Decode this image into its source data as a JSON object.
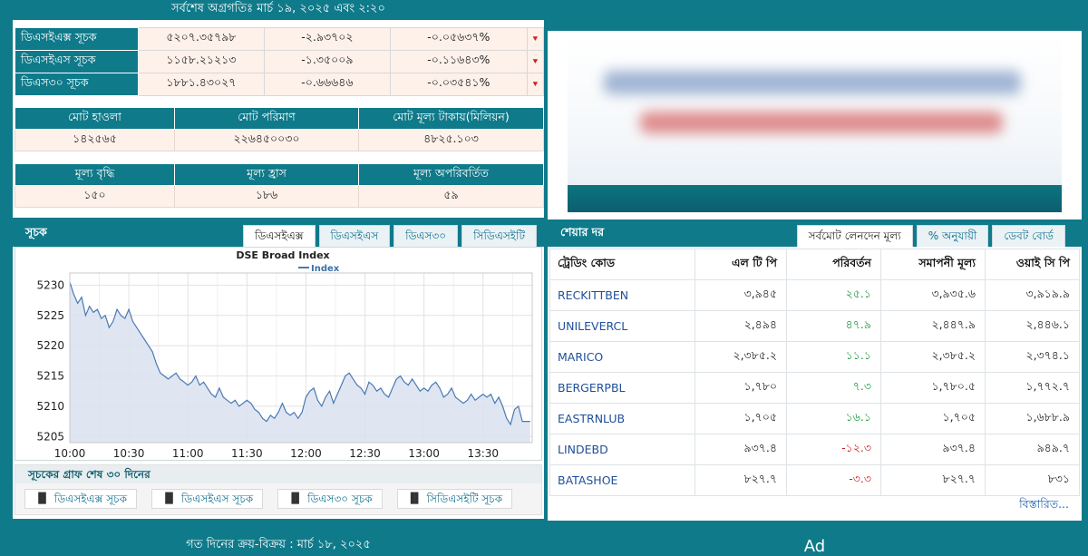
{
  "header": {
    "latest_update": "সর্বশেষ অগ্রগতিঃ মার্চ ১৯, ২০২৫ এবং ২:২০"
  },
  "indices": [
    {
      "name": "ডিএসইএক্স সূচক",
      "value": "৫২০৭.৩৫৭৯৮",
      "change": "-২.৯৩৭০২",
      "pct": "-০.০৫৬৩৭%"
    },
    {
      "name": "ডিএসইএস সূচক",
      "value": "১১৫৮.২১২১৩",
      "change": "-১.৩৫০০৯",
      "pct": "-০.১১৬৪৩%"
    },
    {
      "name": "ডিএস৩০ সূচক",
      "value": "১৮৮১.৪৩০২৭",
      "change": "-০.৬৬৬৪৬",
      "pct": "-০.০৩৫৪১%"
    }
  ],
  "trade_summary": {
    "headers": [
      "মোট হাওলা",
      "মোট পরিমাণ",
      "মোট মূল্য টাকায়(মিলিয়ন)"
    ],
    "values": [
      "১৪২৫৬৫",
      "২২৬৪৫০০৩০",
      "৪৮২৫.১০৩"
    ]
  },
  "price_summary": {
    "headers": [
      "মূল্য বৃদ্ধি",
      "মূল্য হ্রাস",
      "মূল্য অপরিবর্তিত"
    ],
    "values": [
      "১৫০",
      "১৮৬",
      "৫৯"
    ]
  },
  "index_panel": {
    "title": "সূচক",
    "tabs": [
      "ডিএসইএক্স",
      "ডিএসইএস",
      "ডিএস৩০",
      "সিডিএসইটি"
    ],
    "active_tab": 0,
    "footer_title": "সূচকের গ্রাফ শেষ ৩০ দিনের",
    "links": [
      "ডিএসইএক্স সূচক",
      "ডিএসইএস সূচক",
      "ডিএস৩০ সূচক",
      "সিডিএসইটি সূচক"
    ]
  },
  "chart_data": {
    "type": "area",
    "title": "DSE Broad Index",
    "series": [
      {
        "name": "Index"
      }
    ],
    "ylim": [
      5204,
      5232
    ],
    "yticks": [
      5205,
      5210,
      5215,
      5220,
      5225,
      5230
    ],
    "xticks": [
      "10:00",
      "10:30",
      "11:00",
      "11:30",
      "12:00",
      "12:30",
      "13:00",
      "13:30"
    ],
    "x_minutes": [
      0,
      2,
      4,
      6,
      8,
      10,
      12,
      14,
      16,
      18,
      20,
      22,
      24,
      26,
      28,
      30,
      32,
      34,
      36,
      38,
      40,
      42,
      44,
      46,
      48,
      50,
      52,
      54,
      56,
      58,
      60,
      62,
      64,
      66,
      68,
      70,
      72,
      74,
      76,
      78,
      80,
      82,
      84,
      86,
      88,
      90,
      92,
      94,
      96,
      98,
      100,
      102,
      104,
      106,
      108,
      110,
      112,
      114,
      116,
      118,
      120,
      122,
      124,
      126,
      128,
      130,
      132,
      134,
      136,
      138,
      140,
      142,
      144,
      146,
      148,
      150,
      152,
      154,
      156,
      158,
      160,
      162,
      164,
      166,
      168,
      170,
      172,
      174,
      176,
      178,
      180,
      182,
      184,
      186,
      188,
      190,
      192,
      194,
      196,
      198,
      200,
      202,
      204,
      206,
      208,
      210,
      212,
      214,
      216,
      218,
      220,
      222,
      224,
      226,
      228,
      230,
      232,
      234
    ],
    "values": [
      5230.5,
      5228.5,
      5227,
      5228,
      5225,
      5226.5,
      5225.5,
      5226,
      5224.5,
      5225,
      5223,
      5224,
      5226,
      5225,
      5224.5,
      5226,
      5224,
      5223,
      5222,
      5221,
      5220,
      5219,
      5217,
      5215.5,
      5215,
      5214.5,
      5215,
      5215.5,
      5214.5,
      5214,
      5213.5,
      5214,
      5215,
      5213.5,
      5214,
      5213,
      5212,
      5211.5,
      5213,
      5211.5,
      5211,
      5210.5,
      5211,
      5210,
      5210.5,
      5211,
      5210.5,
      5209.5,
      5209,
      5208,
      5207.5,
      5208.5,
      5208,
      5209,
      5210.5,
      5209,
      5208.5,
      5209,
      5208,
      5209,
      5211.5,
      5212.5,
      5213,
      5211,
      5210,
      5211.5,
      5212.5,
      5210.5,
      5212,
      5213.5,
      5215,
      5215.5,
      5214.5,
      5213.5,
      5213,
      5212,
      5214,
      5213.5,
      5212.5,
      5213,
      5212,
      5211.5,
      5213,
      5214.5,
      5215,
      5214,
      5213.5,
      5214.5,
      5213.5,
      5212.5,
      5213,
      5212.5,
      5213.5,
      5214,
      5213,
      5211.5,
      5212,
      5213,
      5211.5,
      5211,
      5210.5,
      5211,
      5212,
      5211,
      5211.5,
      5212,
      5211.5,
      5212,
      5210.5,
      5211.5,
      5210,
      5208,
      5207,
      5209.5,
      5210,
      5207.5,
      5207.5,
      5207.5
    ]
  },
  "share_panel": {
    "title": "শেয়ার দর",
    "tabs": [
      "সর্বমোট লেনদেন মূল্য",
      "% অনুযায়ী",
      "ডেবট বোর্ড"
    ],
    "active_tab": 0,
    "headers": [
      "ট্রেডিং কোড",
      "এল টি পি",
      "পরিবর্তন",
      "সমাপনী মূল্য",
      "ওয়াই সি পি"
    ],
    "rows": [
      {
        "code": "RECKITTBEN",
        "ltp": "৩,৯৪৫",
        "change": "২৫.১",
        "dir": "up",
        "close": "৩,৯৩৫.৬",
        "ycp": "৩,৯১৯.৯"
      },
      {
        "code": "UNILEVERCL",
        "ltp": "২,৪৯৪",
        "change": "৪৭.৯",
        "dir": "up",
        "close": "২,৪৪৭.৯",
        "ycp": "২,৪৪৬.১"
      },
      {
        "code": "MARICO",
        "ltp": "২,৩৮৫.২",
        "change": "১১.১",
        "dir": "up",
        "close": "২,৩৮৫.২",
        "ycp": "২,৩৭৪.১"
      },
      {
        "code": "BERGERPBL",
        "ltp": "১,৭৮০",
        "change": "৭.৩",
        "dir": "up",
        "close": "১,৭৮০.৫",
        "ycp": "১,৭৭২.৭"
      },
      {
        "code": "EASTRNLUB",
        "ltp": "১,৭০৫",
        "change": "১৬.১",
        "dir": "up",
        "close": "১,৭০৫",
        "ycp": "১,৬৮৮.৯"
      },
      {
        "code": "LINDEBD",
        "ltp": "৯৩৭.৪",
        "change": "-১২.৩",
        "dir": "down",
        "close": "৯৩৭.৪",
        "ycp": "৯৪৯.৭"
      },
      {
        "code": "BATASHOE",
        "ltp": "৮২৭.৭",
        "change": "-৩.৩",
        "dir": "down",
        "close": "৮২৭.৭",
        "ycp": "৮৩১"
      }
    ],
    "more_link": "বিস্তারিত..."
  },
  "bottom": {
    "prev_day": "গত দিনের ক্রয়-বিক্রয় : মার্চ ১৮, ২০২৫",
    "ad_text": "Ad"
  },
  "colors": {
    "teal": "#0f7a8a",
    "up": "#1e9a3c",
    "down": "#d21f1f",
    "chart_line": "#4a79b5",
    "chart_fill": "#d9e2ef"
  }
}
